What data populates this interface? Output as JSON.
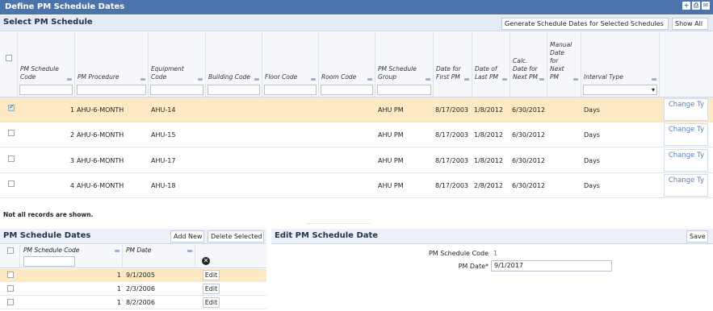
{
  "window": {
    "title": "Define PM Schedule Dates"
  },
  "top_section": {
    "title": "Select PM Schedule",
    "generate_button": "Generate Schedule Dates for Selected Schedules",
    "show_all_button": "Show All"
  },
  "columns": {
    "pm_schedule_code": "PM Schedule Code",
    "pm_procedure": "PM Procedure",
    "equipment_code": "Equipment Code",
    "building_code": "Building Code",
    "floor_code": "Floor Code",
    "room_code": "Room Code",
    "pm_schedule_group": "PM Schedule Group",
    "date_first_pm": "Date for First PM",
    "date_last_pm": "Date of Last PM",
    "calc_date_next_pm": "Calc. Date for Next PM",
    "manual_date_next_pm": "Manual Date for Next PM",
    "interval_type": "Interval Type"
  },
  "rows": [
    {
      "selected": true,
      "code": "1",
      "procedure": "AHU-6-MONTH",
      "equipment": "AHU-14",
      "group": "AHU PM",
      "first_pm": "8/17/2003",
      "last_pm": "1/8/2012",
      "calc_next": "6/30/2012",
      "interval": "Days",
      "change": "Change Ty"
    },
    {
      "selected": false,
      "code": "2",
      "procedure": "AHU-6-MONTH",
      "equipment": "AHU-15",
      "group": "AHU PM",
      "first_pm": "8/17/2003",
      "last_pm": "1/8/2012",
      "calc_next": "6/30/2012",
      "interval": "Days",
      "change": "Change Ty"
    },
    {
      "selected": false,
      "code": "3",
      "procedure": "AHU-6-MONTH",
      "equipment": "AHU-17",
      "group": "AHU PM",
      "first_pm": "8/17/2003",
      "last_pm": "1/8/2012",
      "calc_next": "6/30/2012",
      "interval": "Days",
      "change": "Change Ty"
    },
    {
      "selected": false,
      "code": "4",
      "procedure": "AHU-6-MONTH",
      "equipment": "AHU-18",
      "group": "AHU PM",
      "first_pm": "8/17/2003",
      "last_pm": "2/8/2012",
      "calc_next": "6/30/2012",
      "interval": "Days",
      "change": "Change Ty"
    }
  ],
  "notice": "Not all records are shown.",
  "dates_panel": {
    "title": "PM Schedule Dates",
    "add_new": "Add New",
    "delete_selected": "Delete Selected",
    "col_code": "PM Schedule Code",
    "col_date": "PM Date",
    "rows": [
      {
        "selected": true,
        "code": "1",
        "date": "9/1/2005",
        "edit": "Edit"
      },
      {
        "selected": false,
        "code": "1",
        "date": "2/3/2006",
        "edit": "Edit"
      },
      {
        "selected": false,
        "code": "1",
        "date": "8/2/2006",
        "edit": "Edit"
      }
    ]
  },
  "edit_panel": {
    "title": "Edit PM Schedule Date",
    "save": "Save",
    "code_label": "PM Schedule Code",
    "code_value": "1",
    "date_label": "PM Date*",
    "date_value": "9/1/2017"
  }
}
